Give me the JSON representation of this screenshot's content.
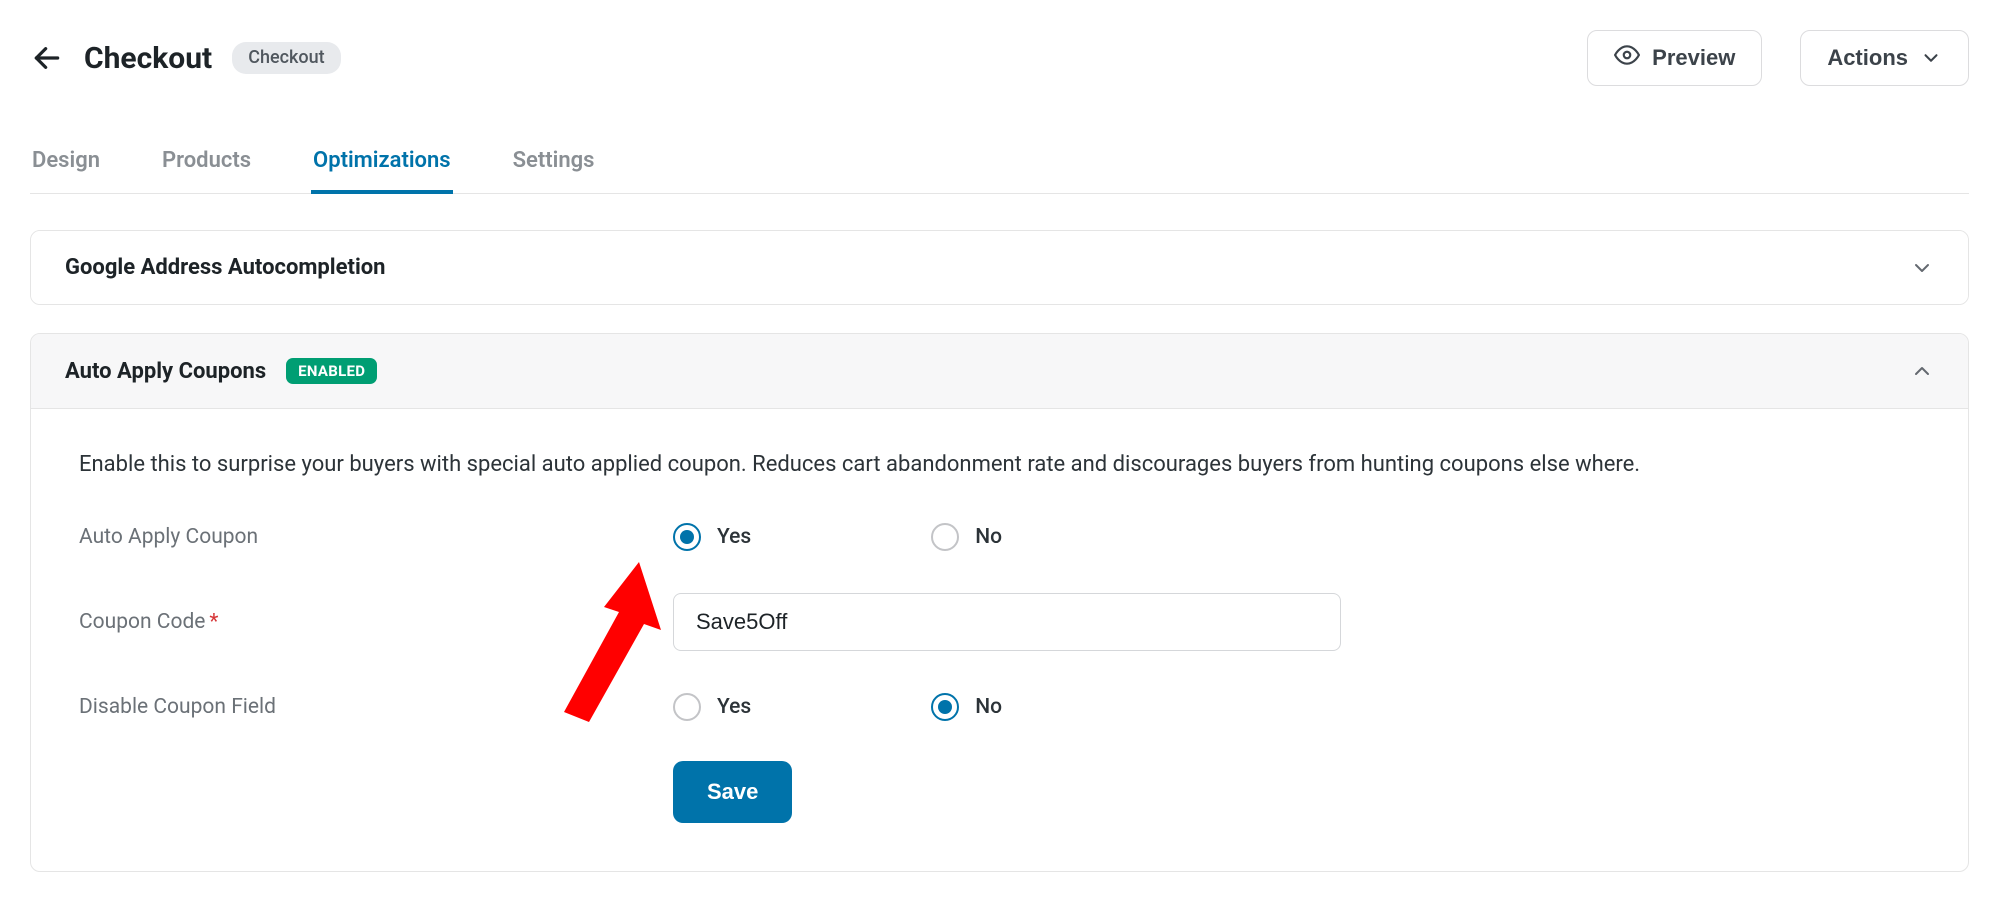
{
  "header": {
    "title": "Checkout",
    "badge": "Checkout",
    "preview_label": "Preview",
    "actions_label": "Actions"
  },
  "tabs": {
    "design": "Design",
    "products": "Products",
    "optimizations": "Optimizations",
    "settings": "Settings"
  },
  "panels": {
    "google": {
      "title": "Google Address Autocompletion"
    },
    "coupons": {
      "title": "Auto Apply Coupons",
      "enabled_badge": "ENABLED",
      "desc": "Enable this to surprise your buyers with special auto applied coupon. Reduces cart abandonment rate and discourages buyers from hunting coupons else where.",
      "auto_apply_label": "Auto Apply Coupon",
      "yes": "Yes",
      "no": "No",
      "coupon_code_label": "Coupon Code",
      "coupon_code_value": "Save5Off",
      "disable_field_label": "Disable Coupon Field",
      "save": "Save"
    }
  }
}
